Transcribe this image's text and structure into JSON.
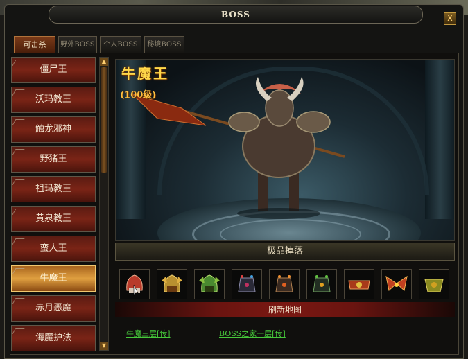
{
  "window": {
    "title": "BOSS",
    "close_label": "X"
  },
  "tabs": [
    {
      "label": "可击杀",
      "active": true
    },
    {
      "label": "野外BOSS",
      "active": false
    },
    {
      "label": "个人BOSS",
      "active": false
    },
    {
      "label": "秘境BOSS",
      "active": false
    }
  ],
  "boss_list": [
    "僵尸王",
    "沃玛教王",
    "触龙邪神",
    "野猪王",
    "祖玛教王",
    "黄泉教王",
    "蛮人王",
    "牛魔王",
    "赤月恶魔",
    "海魔护法"
  ],
  "selected_boss": "牛魔王",
  "preview": {
    "name": "牛魔王",
    "level": "(100级)"
  },
  "drops": {
    "header": "极品掉落",
    "items": [
      "red-helmet-icon",
      "gold-helmet-icon",
      "green-helmet-icon",
      "dark-armor-gem-icon",
      "dark-armor-orange-icon",
      "dark-armor-green-icon",
      "red-belt-icon",
      "red-wings-icon",
      "gold-boots-icon"
    ]
  },
  "refresh": {
    "header": "刷新地图",
    "maps": [
      "牛魔三层[传]",
      "BOSS之家一层[传]"
    ]
  },
  "colors": {
    "accent_gold": "#ffd84a",
    "list_red": "#7a2416",
    "list_selected": "#e0a040",
    "link_green": "#46c83a"
  }
}
